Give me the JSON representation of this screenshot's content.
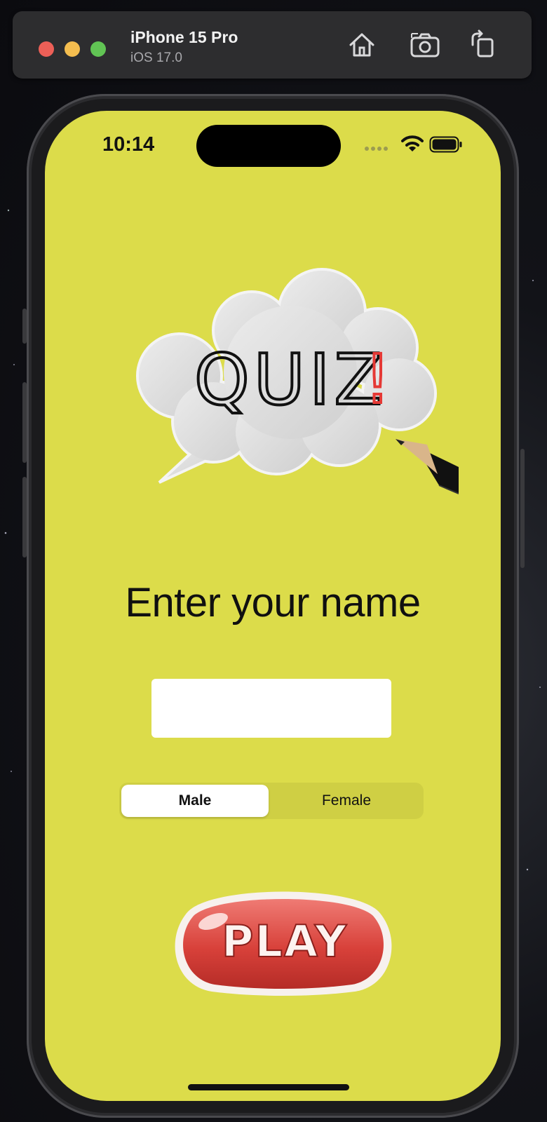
{
  "simulator": {
    "device_name": "iPhone 15 Pro",
    "os_version": "iOS 17.0",
    "toolbar_icons": [
      "home-icon",
      "screenshot-icon",
      "rotate-icon"
    ]
  },
  "status_bar": {
    "time": "10:14",
    "icons": [
      "cellular-signal-icon",
      "wifi-icon",
      "battery-icon"
    ]
  },
  "logo": {
    "text": "QUIZ",
    "accent_text": "!",
    "accent_color": "#e53935"
  },
  "form": {
    "prompt": "Enter your name",
    "name_value": "",
    "gender_options": [
      "Male",
      "Female"
    ],
    "gender_selected": "Male"
  },
  "play_button": {
    "label": "PLAY",
    "color": "#d8413a"
  },
  "theme": {
    "background": "#dcdc4a",
    "segment_track": "#cfcf44"
  }
}
